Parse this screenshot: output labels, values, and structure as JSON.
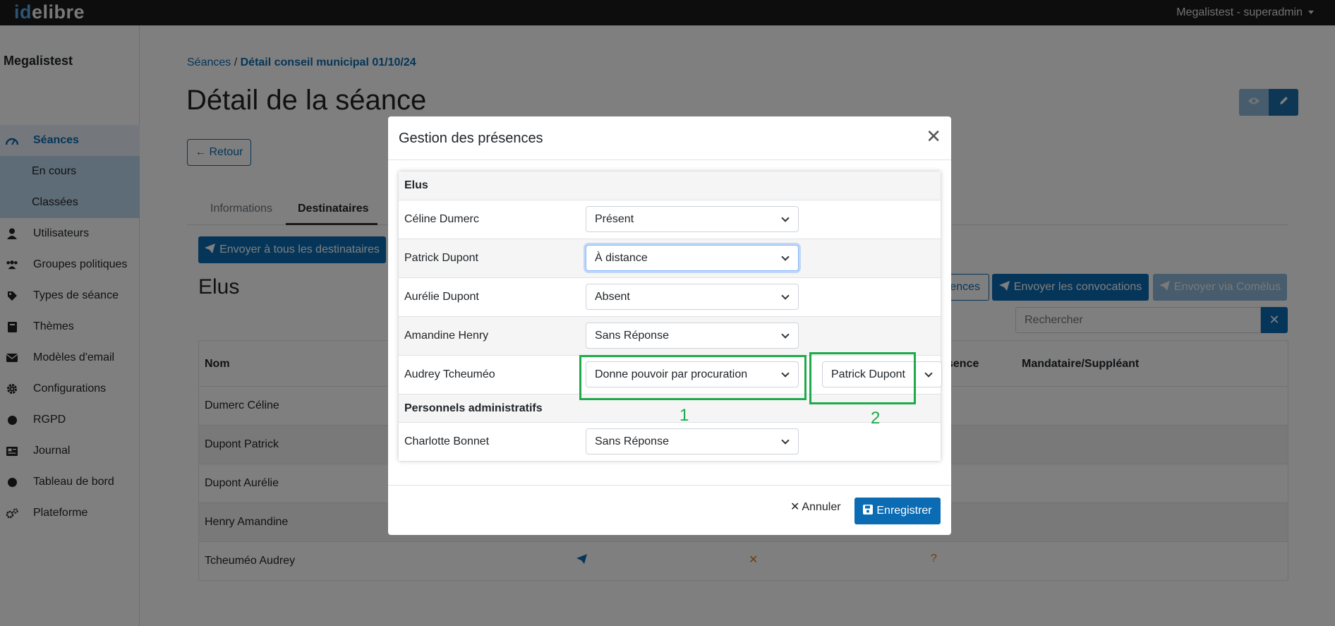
{
  "app": {
    "logo_id": "id",
    "logo_rest": "elibre",
    "user_menu": "Megalistest - superadmin"
  },
  "sidebar": {
    "org": "Megalistest",
    "items": [
      {
        "label": "Séances",
        "icon": "dashboard-icon",
        "active": true
      },
      {
        "label": "En cours",
        "sub": true
      },
      {
        "label": "Classées",
        "sub": true
      },
      {
        "label": "Utilisateurs",
        "icon": "user-icon"
      },
      {
        "label": "Groupes politiques",
        "icon": "users-icon"
      },
      {
        "label": "Types de séance",
        "icon": "tag-icon"
      },
      {
        "label": "Thèmes",
        "icon": "book-icon"
      },
      {
        "label": "Modèles d'email",
        "icon": "envelope-icon"
      },
      {
        "label": "Configurations",
        "icon": "gear-icon"
      },
      {
        "label": "RGPD",
        "icon": "globe-icon"
      },
      {
        "label": "Journal",
        "icon": "newspaper-icon"
      },
      {
        "label": "Tableau de bord",
        "icon": "gauge-icon"
      },
      {
        "label": "Plateforme",
        "icon": "cogs-icon"
      }
    ]
  },
  "main": {
    "breadcrumb_root": "Séances",
    "breadcrumb_sep": " / ",
    "breadcrumb_current": "Détail conseil municipal 01/10/24",
    "title": "Détail de la séance",
    "back_label": "Retour",
    "tabs": [
      "Informations",
      "Destinataires"
    ],
    "send_all_label": "Envoyer à tous les destinataires",
    "section_title": "Elus",
    "presence_btn_partial": "ences",
    "send_conv_label": "Envoyer les convocations",
    "send_comelus_label": "Envoyer via Comélus",
    "search_placeholder": "Rechercher",
    "table": {
      "headers": [
        "Nom",
        "sence",
        "Mandataire/Suppléant"
      ],
      "rows": [
        {
          "name": "Dumerc Céline"
        },
        {
          "name": "Dupont Patrick"
        },
        {
          "name": "Dupont Aurélie"
        },
        {
          "name": "Henry Amandine"
        },
        {
          "name": "Tcheuméo Audrey",
          "c2": "✕",
          "c3": "?"
        }
      ]
    }
  },
  "modal": {
    "title": "Gestion des présences",
    "sections": {
      "elus": "Elus",
      "admin": "Personnels administratifs"
    },
    "rows": [
      {
        "name": "Céline Dumerc",
        "status": "Présent"
      },
      {
        "name": "Patrick Dupont",
        "status": "À distance"
      },
      {
        "name": "Aurélie Dupont",
        "status": "Absent"
      },
      {
        "name": "Amandine Henry",
        "status": "Sans Réponse"
      },
      {
        "name": "Audrey Tcheuméo",
        "status": "Donne pouvoir par procuration",
        "proxy": "Patrick Dupont"
      },
      {
        "name": "Charlotte Bonnet",
        "status": "Sans Réponse"
      }
    ],
    "annotations": [
      "1",
      "2"
    ],
    "cancel_label": "Annuler",
    "save_label": "Enregistrer"
  },
  "colors": {
    "primary": "#0b6bb3",
    "highlight": "#1eaa4a",
    "warning": "#e07b1a"
  }
}
